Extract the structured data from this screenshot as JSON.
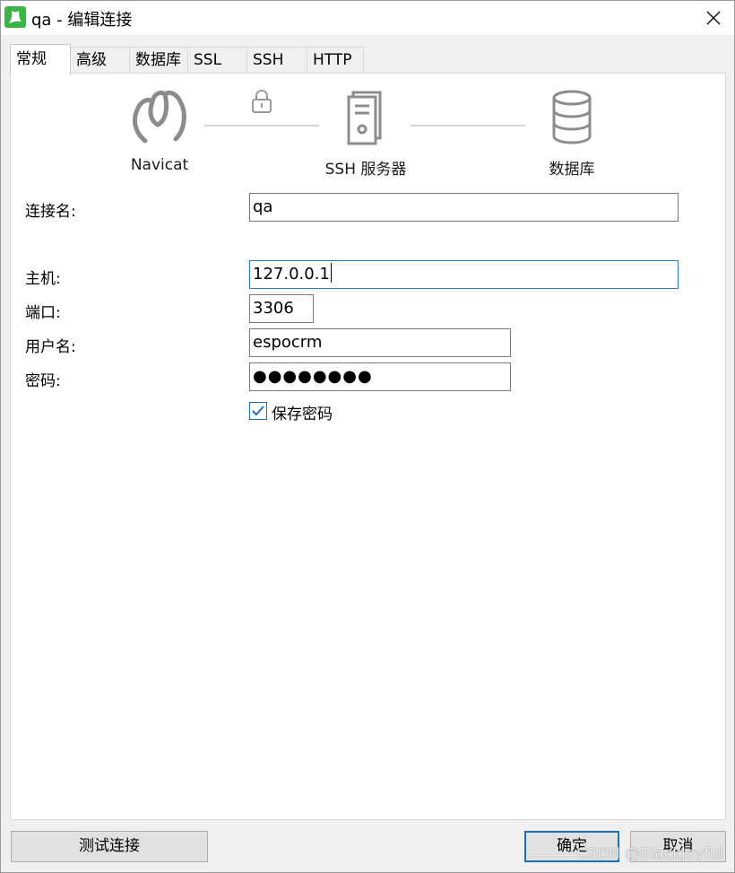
{
  "window": {
    "title": "qa - 编辑连接",
    "accent_color": "#3bb54a"
  },
  "tabs": [
    {
      "label": "常规",
      "active": true
    },
    {
      "label": "高级",
      "active": false
    },
    {
      "label": "数据库",
      "active": false
    },
    {
      "label": "SSL",
      "active": false
    },
    {
      "label": "SSH",
      "active": false
    },
    {
      "label": "HTTP",
      "active": false
    }
  ],
  "diagram": {
    "navicat_label": "Navicat",
    "ssh_label": "SSH 服务器",
    "database_label": "数据库",
    "icons": [
      "navicat-icon",
      "lock-icon",
      "server-icon",
      "database-icon"
    ]
  },
  "form": {
    "connection_name_label": "连接名:",
    "connection_name_value": "qa",
    "host_label": "主机:",
    "host_value": "127.0.0.1",
    "port_label": "端口:",
    "port_value": "3306",
    "username_label": "用户名:",
    "username_value": "espocrm",
    "password_label": "密码:",
    "password_value": "●●●●●●●●",
    "save_password_label": "保存密码",
    "save_password_checked": true
  },
  "buttons": {
    "test_label": "测试连接",
    "ok_label": "确定",
    "cancel_label": "取消"
  },
  "watermark": "CSDN @BlackJoyful"
}
